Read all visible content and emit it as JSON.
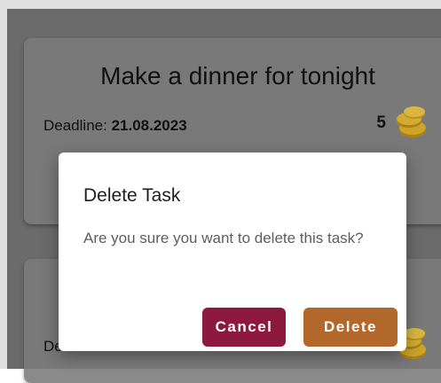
{
  "cards": [
    {
      "title": "Make a dinner for tonight",
      "deadline_label": "Deadline: ",
      "deadline_value": "21.08.2023",
      "reward": "5"
    },
    {
      "title": "",
      "deadline_label": "De",
      "deadline_value": "",
      "reward": ""
    }
  ],
  "dialog": {
    "title": "Delete Task",
    "message": "Are you sure you want to delete this task?",
    "cancel_label": "Cancel",
    "delete_label": "Delete"
  },
  "colors": {
    "cancel_button": "#8d1a3e",
    "delete_button": "#b3682b",
    "coin": "#e9bb2e"
  },
  "icons": {
    "reward": "coin-stack-icon"
  }
}
